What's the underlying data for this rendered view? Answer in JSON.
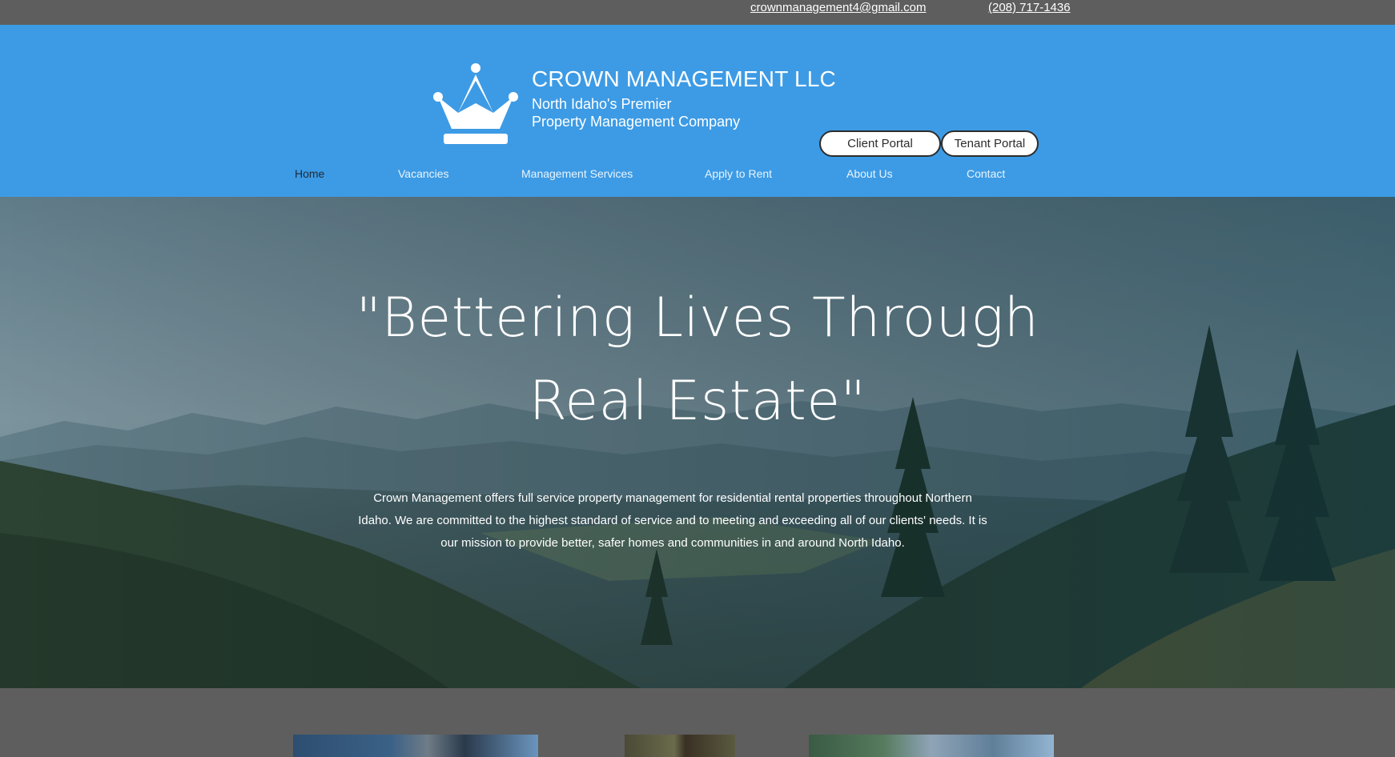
{
  "topbar": {
    "email": "crownmanagement4@gmail.com",
    "phone": "(208) 717-1436"
  },
  "header": {
    "logo_icon": "crown-icon",
    "company_name": "CROWN MANAGEMENT LLC",
    "tagline_line1": "North Idaho's Premier",
    "tagline_line2": "Property Management Company",
    "client_portal": "Client Portal",
    "tenant_portal": "Tenant Portal",
    "colors": {
      "header_bg": "#3d9be5",
      "topbar_bg": "#5e5e5e"
    }
  },
  "nav": {
    "active": "Home",
    "items": [
      {
        "label": "Home"
      },
      {
        "label": "Vacancies"
      },
      {
        "label": "Management Services"
      },
      {
        "label": "Apply to Rent"
      },
      {
        "label": "About Us"
      },
      {
        "label": "Contact"
      }
    ]
  },
  "hero": {
    "title_line1": "\"Bettering Lives Through",
    "title_line2": "Real Estate\"",
    "body": "Crown Management offers full service property management for residential rental properties throughout Northern Idaho. We are committed to the highest standard of service and to meeting and exceeding all of our clients' needs. It is our mission to provide better, safer homes and communities in and around North Idaho."
  }
}
